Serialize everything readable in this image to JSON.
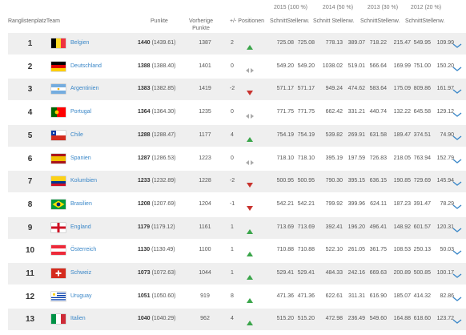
{
  "year_headers": [
    "2015 (100 %)",
    "2014 (50 %)",
    "2013 (30 %)",
    "2012 (20 %)"
  ],
  "columns": {
    "rank_team": "RanglistenplatzTeam",
    "punkte": "Punkte",
    "vorherige": "Vorherige",
    "vorherige2": "Punkte",
    "positionen": "+/- Positionen",
    "y2015": "SchnittStellenw.",
    "y2014": "Schnitt Stellenw.",
    "y2013": "SchnittStellenw.",
    "y2012": "SchnittStellenw."
  },
  "trend_colors": {
    "up": "#3aa54a",
    "down": "#c8332e",
    "same": "#aaaaaa"
  },
  "link_color": "#3a87c8",
  "rows": [
    {
      "rank": "1",
      "team": "Belgien",
      "flag": "belgium-flag-icon",
      "points": "1440",
      "points_exact": "(1439.61)",
      "prev": "1387",
      "delta": "2",
      "trend": "up",
      "v": [
        "725.08",
        "725.08",
        "778.13",
        "389.07",
        "718.22",
        "215.47",
        "549.95",
        "109.99"
      ]
    },
    {
      "rank": "2",
      "team": "Deutschland",
      "flag": "germany-flag-icon",
      "points": "1388",
      "points_exact": "(1388.40)",
      "prev": "1401",
      "delta": "0",
      "trend": "same",
      "v": [
        "549.20",
        "549.20",
        "1038.02",
        "519.01",
        "566.64",
        "169.99",
        "751.00",
        "150.20"
      ]
    },
    {
      "rank": "3",
      "team": "Argentinien",
      "flag": "argentina-flag-icon",
      "points": "1383",
      "points_exact": "(1382.85)",
      "prev": "1419",
      "delta": "-2",
      "trend": "down",
      "v": [
        "571.17",
        "571.17",
        "949.24",
        "474.62",
        "583.64",
        "175.09",
        "809.86",
        "161.97"
      ]
    },
    {
      "rank": "4",
      "team": "Portugal",
      "flag": "portugal-flag-icon",
      "points": "1364",
      "points_exact": "(1364.30)",
      "prev": "1235",
      "delta": "0",
      "trend": "same",
      "v": [
        "771.75",
        "771.75",
        "662.42",
        "331.21",
        "440.74",
        "132.22",
        "645.58",
        "129.12"
      ]
    },
    {
      "rank": "5",
      "team": "Chile",
      "flag": "chile-flag-icon",
      "points": "1288",
      "points_exact": "(1288.47)",
      "prev": "1177",
      "delta": "4",
      "trend": "up",
      "v": [
        "754.19",
        "754.19",
        "539.82",
        "269.91",
        "631.58",
        "189.47",
        "374.51",
        "74.90"
      ]
    },
    {
      "rank": "6",
      "team": "Spanien",
      "flag": "spain-flag-icon",
      "points": "1287",
      "points_exact": "(1286.53)",
      "prev": "1223",
      "delta": "0",
      "trend": "same",
      "v": [
        "718.10",
        "718.10",
        "395.19",
        "197.59",
        "726.83",
        "218.05",
        "763.94",
        "152.79"
      ]
    },
    {
      "rank": "7",
      "team": "Kolumbien",
      "flag": "colombia-flag-icon",
      "points": "1233",
      "points_exact": "(1232.89)",
      "prev": "1228",
      "delta": "-2",
      "trend": "down",
      "v": [
        "500.95",
        "500.95",
        "790.30",
        "395.15",
        "636.15",
        "190.85",
        "729.69",
        "145.94"
      ]
    },
    {
      "rank": "8",
      "team": "Brasilien",
      "flag": "brazil-flag-icon",
      "points": "1208",
      "points_exact": "(1207.69)",
      "prev": "1204",
      "delta": "-1",
      "trend": "down",
      "v": [
        "542.21",
        "542.21",
        "799.92",
        "399.96",
        "624.11",
        "187.23",
        "391.47",
        "78.29"
      ]
    },
    {
      "rank": "9",
      "team": "England",
      "flag": "england-flag-icon",
      "points": "1179",
      "points_exact": "(1179.12)",
      "prev": "1161",
      "delta": "1",
      "trend": "up",
      "v": [
        "713.69",
        "713.69",
        "392.41",
        "196.20",
        "496.41",
        "148.92",
        "601.57",
        "120.31"
      ]
    },
    {
      "rank": "10",
      "team": "Österreich",
      "flag": "austria-flag-icon",
      "points": "1130",
      "points_exact": "(1130.49)",
      "prev": "1100",
      "delta": "1",
      "trend": "up",
      "v": [
        "710.88",
        "710.88",
        "522.10",
        "261.05",
        "361.75",
        "108.53",
        "250.13",
        "50.03"
      ]
    },
    {
      "rank": "11",
      "team": "Schweiz",
      "flag": "switzerland-flag-icon",
      "points": "1073",
      "points_exact": "(1072.63)",
      "prev": "1044",
      "delta": "1",
      "trend": "up",
      "v": [
        "529.41",
        "529.41",
        "484.33",
        "242.16",
        "669.63",
        "200.89",
        "500.85",
        "100.17"
      ]
    },
    {
      "rank": "12",
      "team": "Uruguay",
      "flag": "uruguay-flag-icon",
      "points": "1051",
      "points_exact": "(1050.60)",
      "prev": "919",
      "delta": "8",
      "trend": "up",
      "v": [
        "471.36",
        "471.36",
        "622.61",
        "311.31",
        "616.90",
        "185.07",
        "414.32",
        "82.86"
      ]
    },
    {
      "rank": "13",
      "team": "Italien",
      "flag": "italy-flag-icon",
      "points": "1040",
      "points_exact": "(1040.29)",
      "prev": "962",
      "delta": "4",
      "trend": "up",
      "v": [
        "515.20",
        "515.20",
        "472.98",
        "236.49",
        "549.60",
        "164.88",
        "618.60",
        "123.72"
      ]
    }
  ]
}
